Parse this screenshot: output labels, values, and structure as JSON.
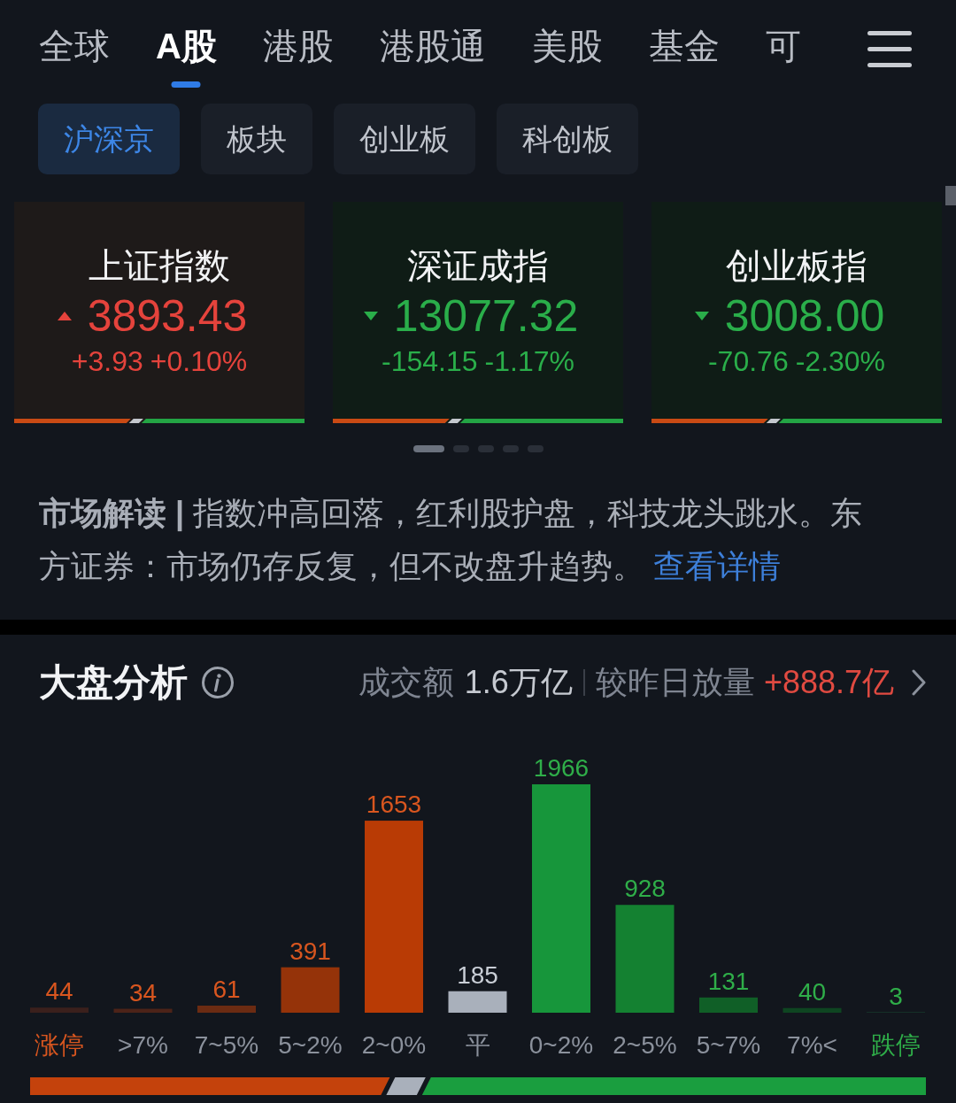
{
  "top_tabs": [
    {
      "label": "全球",
      "selected": false
    },
    {
      "label": "A股",
      "selected": true
    },
    {
      "label": "港股",
      "selected": false
    },
    {
      "label": "港股通",
      "selected": false
    },
    {
      "label": "美股",
      "selected": false
    },
    {
      "label": "基金",
      "selected": false
    },
    {
      "label": "可",
      "selected": false
    }
  ],
  "sub_tabs": [
    {
      "label": "沪深京",
      "selected": true
    },
    {
      "label": "板块",
      "selected": false
    },
    {
      "label": "创业板",
      "selected": false
    },
    {
      "label": "科创板",
      "selected": false
    }
  ],
  "index_cards": [
    {
      "name": "上证指数",
      "kind": "up",
      "value": "3893.43",
      "change": "+3.93",
      "change_pct": "+0.10%"
    },
    {
      "name": "深证成指",
      "kind": "down",
      "value": "13077.32",
      "change": "-154.15",
      "change_pct": "-1.17%"
    },
    {
      "name": "创业板指",
      "kind": "down",
      "value": "3008.00",
      "change": "-70.76",
      "change_pct": "-2.30%"
    }
  ],
  "pager": [
    {
      "selected": true
    },
    {
      "selected": false
    },
    {
      "selected": false
    },
    {
      "selected": false
    },
    {
      "selected": false
    }
  ],
  "market_commentary": {
    "text": "**市场解读 |** 指数冲高回落，红利股护盘，科技龙头跳水。东方证券：市场仍存反复，但不改盘升趋势。",
    "link": "查看详情"
  },
  "market_analysis": {
    "title": "大盘分析",
    "turnover_label": "成交额",
    "turnover": "1.6万亿",
    "compare_label": "较昨日放量",
    "compare_value": "+888.7亿",
    "chart_data": {
      "type": "bar",
      "categories": [
        "涨停",
        ">7%",
        "7~5%",
        "5~2%",
        "2~0%",
        "平",
        "0~2%",
        "2~5%",
        "5~7%",
        "7%<",
        "跌停"
      ],
      "values": [
        44,
        34,
        61,
        391,
        1653,
        185,
        1966,
        928,
        131,
        40,
        3
      ],
      "data_labels": true
    }
  }
}
